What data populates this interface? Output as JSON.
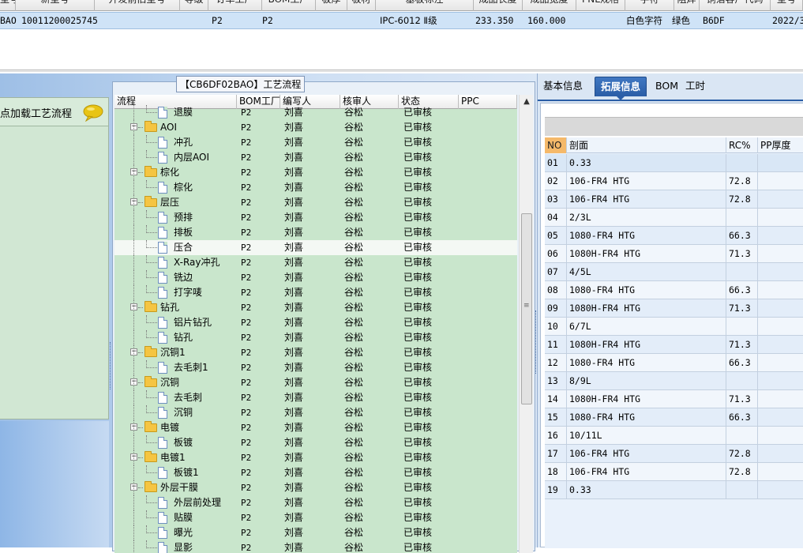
{
  "top_grid": {
    "headers": [
      "型号",
      "新型号",
      "开发前旧型号",
      "等级",
      "订单工厂",
      "BOM工厂",
      "板厚",
      "板材",
      "基板标注",
      "成品长度",
      "成品宽度",
      "PNL规格",
      "字符",
      "阻焊",
      "铜箔客户代码",
      "型号"
    ],
    "row": {
      "code": "BAO",
      "new_model": "10011200025745",
      "order_factory": "P2",
      "bom_factory": "P2",
      "base_mark": "IPC-6012 Ⅱ级",
      "length": "233.350",
      "width": "160.000",
      "char": "白色字符",
      "mask": "绿色",
      "cust_code": "B6DF",
      "date": "2022/3/"
    }
  },
  "left": {
    "load_label": "点加载工艺流程",
    "group_title": "【CB6DF02BAO】工艺流程",
    "tree_headers": [
      "流程",
      "BOM工厂",
      "编写人",
      "核审人",
      "状态",
      "PPC"
    ],
    "rows": [
      {
        "name": "退膜",
        "level": 2,
        "bom": "P2",
        "writer": "刘喜",
        "checker": "谷松",
        "status": "已审核"
      },
      {
        "name": "AOI",
        "level": 1,
        "bom": "P2",
        "writer": "刘喜",
        "checker": "谷松",
        "status": "已审核"
      },
      {
        "name": "冲孔",
        "level": 2,
        "bom": "P2",
        "writer": "刘喜",
        "checker": "谷松",
        "status": "已审核"
      },
      {
        "name": "内层AOI",
        "level": 2,
        "bom": "P2",
        "writer": "刘喜",
        "checker": "谷松",
        "status": "已审核"
      },
      {
        "name": "棕化",
        "level": 1,
        "bom": "P2",
        "writer": "刘喜",
        "checker": "谷松",
        "status": "已审核"
      },
      {
        "name": "棕化",
        "level": 2,
        "bom": "P2",
        "writer": "刘喜",
        "checker": "谷松",
        "status": "已审核"
      },
      {
        "name": "层压",
        "level": 1,
        "bom": "P2",
        "writer": "刘喜",
        "checker": "谷松",
        "status": "已审核"
      },
      {
        "name": "预排",
        "level": 2,
        "bom": "P2",
        "writer": "刘喜",
        "checker": "谷松",
        "status": "已审核"
      },
      {
        "name": "排板",
        "level": 2,
        "bom": "P2",
        "writer": "刘喜",
        "checker": "谷松",
        "status": "已审核"
      },
      {
        "name": "压合",
        "level": 2,
        "bom": "P2",
        "writer": "刘喜",
        "checker": "谷松",
        "status": "已审核",
        "selected": true
      },
      {
        "name": "X-Ray冲孔",
        "level": 2,
        "bom": "P2",
        "writer": "刘喜",
        "checker": "谷松",
        "status": "已审核"
      },
      {
        "name": "铣边",
        "level": 2,
        "bom": "P2",
        "writer": "刘喜",
        "checker": "谷松",
        "status": "已审核"
      },
      {
        "name": "打字唛",
        "level": 2,
        "bom": "P2",
        "writer": "刘喜",
        "checker": "谷松",
        "status": "已审核"
      },
      {
        "name": "钻孔",
        "level": 1,
        "bom": "P2",
        "writer": "刘喜",
        "checker": "谷松",
        "status": "已审核"
      },
      {
        "name": "铝片钻孔",
        "level": 2,
        "bom": "P2",
        "writer": "刘喜",
        "checker": "谷松",
        "status": "已审核"
      },
      {
        "name": "钻孔",
        "level": 2,
        "bom": "P2",
        "writer": "刘喜",
        "checker": "谷松",
        "status": "已审核"
      },
      {
        "name": "沉铜1",
        "level": 1,
        "bom": "P2",
        "writer": "刘喜",
        "checker": "谷松",
        "status": "已审核"
      },
      {
        "name": "去毛刺1",
        "level": 2,
        "bom": "P2",
        "writer": "刘喜",
        "checker": "谷松",
        "status": "已审核"
      },
      {
        "name": "沉铜",
        "level": 1,
        "bom": "P2",
        "writer": "刘喜",
        "checker": "谷松",
        "status": "已审核"
      },
      {
        "name": "去毛刺",
        "level": 2,
        "bom": "P2",
        "writer": "刘喜",
        "checker": "谷松",
        "status": "已审核"
      },
      {
        "name": "沉铜",
        "level": 2,
        "bom": "P2",
        "writer": "刘喜",
        "checker": "谷松",
        "status": "已审核"
      },
      {
        "name": "电镀",
        "level": 1,
        "bom": "P2",
        "writer": "刘喜",
        "checker": "谷松",
        "status": "已审核"
      },
      {
        "name": "板镀",
        "level": 2,
        "bom": "P2",
        "writer": "刘喜",
        "checker": "谷松",
        "status": "已审核"
      },
      {
        "name": "电镀1",
        "level": 1,
        "bom": "P2",
        "writer": "刘喜",
        "checker": "谷松",
        "status": "已审核"
      },
      {
        "name": "板镀1",
        "level": 2,
        "bom": "P2",
        "writer": "刘喜",
        "checker": "谷松",
        "status": "已审核"
      },
      {
        "name": "外层干膜",
        "level": 1,
        "bom": "P2",
        "writer": "刘喜",
        "checker": "谷松",
        "status": "已审核"
      },
      {
        "name": "外层前处理",
        "level": 2,
        "bom": "P2",
        "writer": "刘喜",
        "checker": "谷松",
        "status": "已审核"
      },
      {
        "name": "贴膜",
        "level": 2,
        "bom": "P2",
        "writer": "刘喜",
        "checker": "谷松",
        "status": "已审核"
      },
      {
        "name": "曝光",
        "level": 2,
        "bom": "P2",
        "writer": "刘喜",
        "checker": "谷松",
        "status": "已审核"
      },
      {
        "name": "显影",
        "level": 2,
        "bom": "P2",
        "writer": "刘喜",
        "checker": "谷松",
        "status": "已审核"
      }
    ]
  },
  "right": {
    "tabs": [
      "基本信息",
      "拓展信息",
      "BOM",
      "工时"
    ],
    "active_tab": 1,
    "ext_headers": [
      "NO",
      "剖面",
      "RC%",
      "PP厚度"
    ],
    "ext_rows": [
      {
        "no": "01",
        "section": "0.33",
        "rc": ""
      },
      {
        "no": "02",
        "section": "106-FR4 HTG",
        "rc": "72.8"
      },
      {
        "no": "03",
        "section": "106-FR4 HTG",
        "rc": "72.8"
      },
      {
        "no": "04",
        "section": "2/3L",
        "rc": ""
      },
      {
        "no": "05",
        "section": "1080-FR4 HTG",
        "rc": "66.3"
      },
      {
        "no": "06",
        "section": "1080H-FR4 HTG",
        "rc": "71.3"
      },
      {
        "no": "07",
        "section": "4/5L",
        "rc": ""
      },
      {
        "no": "08",
        "section": "1080-FR4 HTG",
        "rc": "66.3"
      },
      {
        "no": "09",
        "section": "1080H-FR4 HTG",
        "rc": "71.3"
      },
      {
        "no": "10",
        "section": "6/7L",
        "rc": ""
      },
      {
        "no": "11",
        "section": "1080H-FR4 HTG",
        "rc": "71.3"
      },
      {
        "no": "12",
        "section": "1080-FR4 HTG",
        "rc": "66.3"
      },
      {
        "no": "13",
        "section": "8/9L",
        "rc": ""
      },
      {
        "no": "14",
        "section": "1080H-FR4 HTG",
        "rc": "71.3"
      },
      {
        "no": "15",
        "section": "1080-FR4 HTG",
        "rc": "66.3"
      },
      {
        "no": "16",
        "section": "10/11L",
        "rc": ""
      },
      {
        "no": "17",
        "section": "106-FR4 HTG",
        "rc": "72.8"
      },
      {
        "no": "18",
        "section": "106-FR4 HTG",
        "rc": "72.8"
      },
      {
        "no": "19",
        "section": "0.33",
        "rc": ""
      }
    ]
  }
}
